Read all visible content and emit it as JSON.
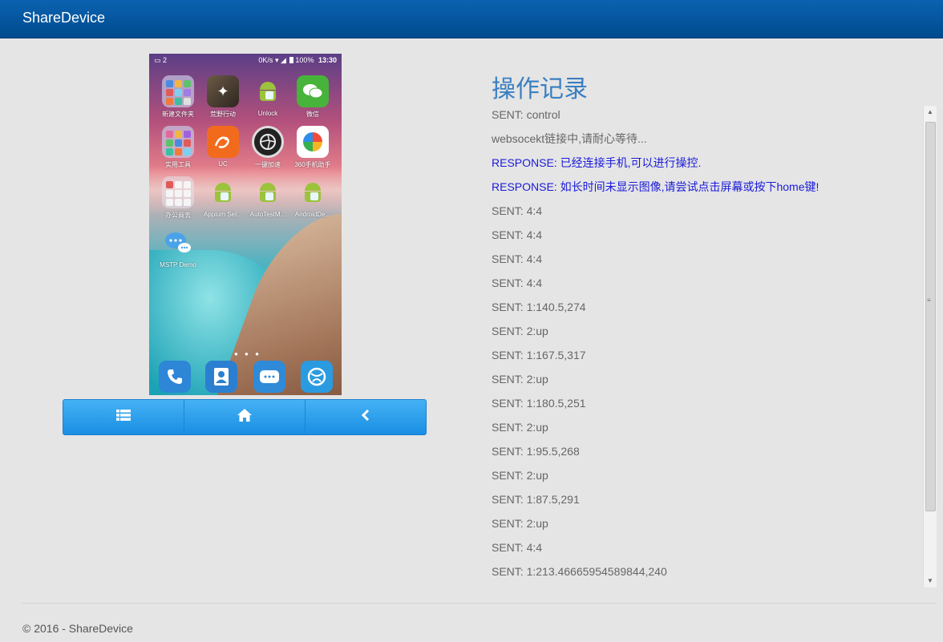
{
  "navbar": {
    "brand": "ShareDevice"
  },
  "phone": {
    "status": {
      "notifications": "2",
      "speed": "0K/s",
      "battery": "100%",
      "time": "13:30"
    },
    "apps": [
      {
        "label": "新建文件夹",
        "icon": "folder-icon"
      },
      {
        "label": "荒野行动",
        "icon": "game-icon"
      },
      {
        "label": "Unlock",
        "icon": "android-icon"
      },
      {
        "label": "微信",
        "icon": "wechat-icon"
      },
      {
        "label": "实用工具",
        "icon": "folder-icon"
      },
      {
        "label": "UC",
        "icon": "uc-browser-icon"
      },
      {
        "label": "一键加速",
        "icon": "speedup-icon"
      },
      {
        "label": "360手机助手",
        "icon": "360-assistant-icon"
      },
      {
        "label": "办公商务",
        "icon": "folder-icon"
      },
      {
        "label": "Appium Set...",
        "icon": "android-icon"
      },
      {
        "label": "AutoTestM...",
        "icon": "android-icon"
      },
      {
        "label": "AndroidDe...",
        "icon": "android-icon"
      },
      {
        "label": "MSTP Demo",
        "icon": "chat-icon"
      }
    ],
    "page_dots": "● ● ●",
    "dock": [
      "phone-icon",
      "contacts-icon",
      "messages-icon",
      "browser-icon"
    ]
  },
  "controls": {
    "menu_icon": "list-icon",
    "home_icon": "home-icon",
    "back_icon": "chevron-left-icon"
  },
  "log": {
    "title": "操作记录",
    "entries": [
      {
        "text": "SENT: control",
        "type": "sent"
      },
      {
        "text": "websocekt链接中,请耐心等待...",
        "type": "sent"
      },
      {
        "text": "RESPONSE: 已经连接手机,可以进行操控.",
        "type": "response"
      },
      {
        "text": "RESPONSE: 如长时间未显示图像,请尝试点击屏幕或按下home键!",
        "type": "response"
      },
      {
        "text": "SENT: 4:4",
        "type": "sent"
      },
      {
        "text": "SENT: 4:4",
        "type": "sent"
      },
      {
        "text": "SENT: 4:4",
        "type": "sent"
      },
      {
        "text": "SENT: 4:4",
        "type": "sent"
      },
      {
        "text": "SENT: 1:140.5,274",
        "type": "sent"
      },
      {
        "text": "SENT: 2:up",
        "type": "sent"
      },
      {
        "text": "SENT: 1:167.5,317",
        "type": "sent"
      },
      {
        "text": "SENT: 2:up",
        "type": "sent"
      },
      {
        "text": "SENT: 1:180.5,251",
        "type": "sent"
      },
      {
        "text": "SENT: 2:up",
        "type": "sent"
      },
      {
        "text": "SENT: 1:95.5,268",
        "type": "sent"
      },
      {
        "text": "SENT: 2:up",
        "type": "sent"
      },
      {
        "text": "SENT: 1:87.5,291",
        "type": "sent"
      },
      {
        "text": "SENT: 2:up",
        "type": "sent"
      },
      {
        "text": "SENT: 4:4",
        "type": "sent"
      },
      {
        "text": "SENT: 1:213.46665954589844,240",
        "type": "sent"
      }
    ]
  },
  "footer": {
    "text": "© 2016 - ShareDevice"
  },
  "colors": {
    "navbar": "#0459a3",
    "accent": "#2a97e9",
    "response_text": "#1a1adb",
    "title": "#3a7fc0"
  }
}
